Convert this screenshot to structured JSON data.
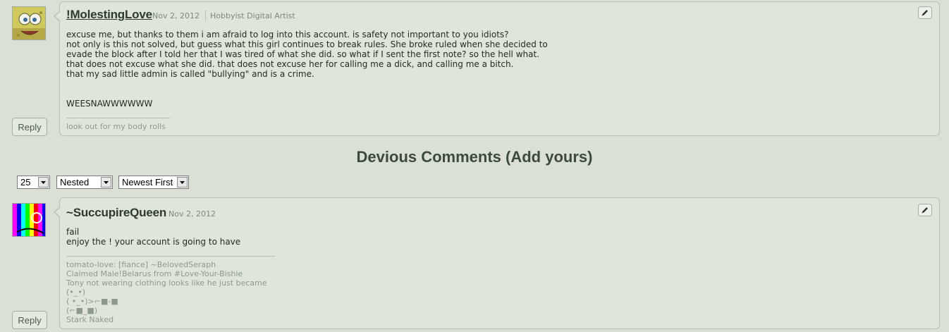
{
  "comments": [
    {
      "author": "!MolestingLove",
      "date": "Nov 2, 2012",
      "role": "Hobbyist Digital Artist",
      "body": "excuse me, but thanks to them i am afraid to log into this account. is safety not important to you idiots?\nnot only is this not solved, but guess what this girl continues to break rules. She broke ruled when she decided to\nevade the block after I told her that I was tired of what she did. so what if I sent the first note? so the hell what.\nthat does not excuse what she did. that does not excuse her for calling me a dick, and calling me a bitch.\nthat my sad little admin is called \"bullying\" and is a crime.\n\n\nWEESNAWWWWWW",
      "signature": "look out for my body rolls",
      "reply_label": "Reply",
      "edit_icon": "pencil-icon"
    },
    {
      "author": "~SuccupireQueen",
      "date": "Nov 2, 2012",
      "body": "fail\nenjoy the ! your account is going to have",
      "signature": "tomato-love: [fiance] ~BelovedSeraph\nClaimed Male!Belarus from #Love-Your-Bishie\nTony not wearing clothing looks like he just became\n(•_•)\n( •_•)>⌐■-■\n(⌐■_■)\nStark Naked",
      "reply_label": "Reply",
      "edit_icon": "pencil-icon"
    }
  ],
  "section": {
    "title": "Devious Comments (Add yours)"
  },
  "controls": {
    "per_page": "25",
    "view_mode": "Nested",
    "sort_order": "Newest First"
  },
  "colors": {
    "background": "#dae0d5",
    "card": "#dfe5da",
    "author": "#2d3a2f"
  }
}
